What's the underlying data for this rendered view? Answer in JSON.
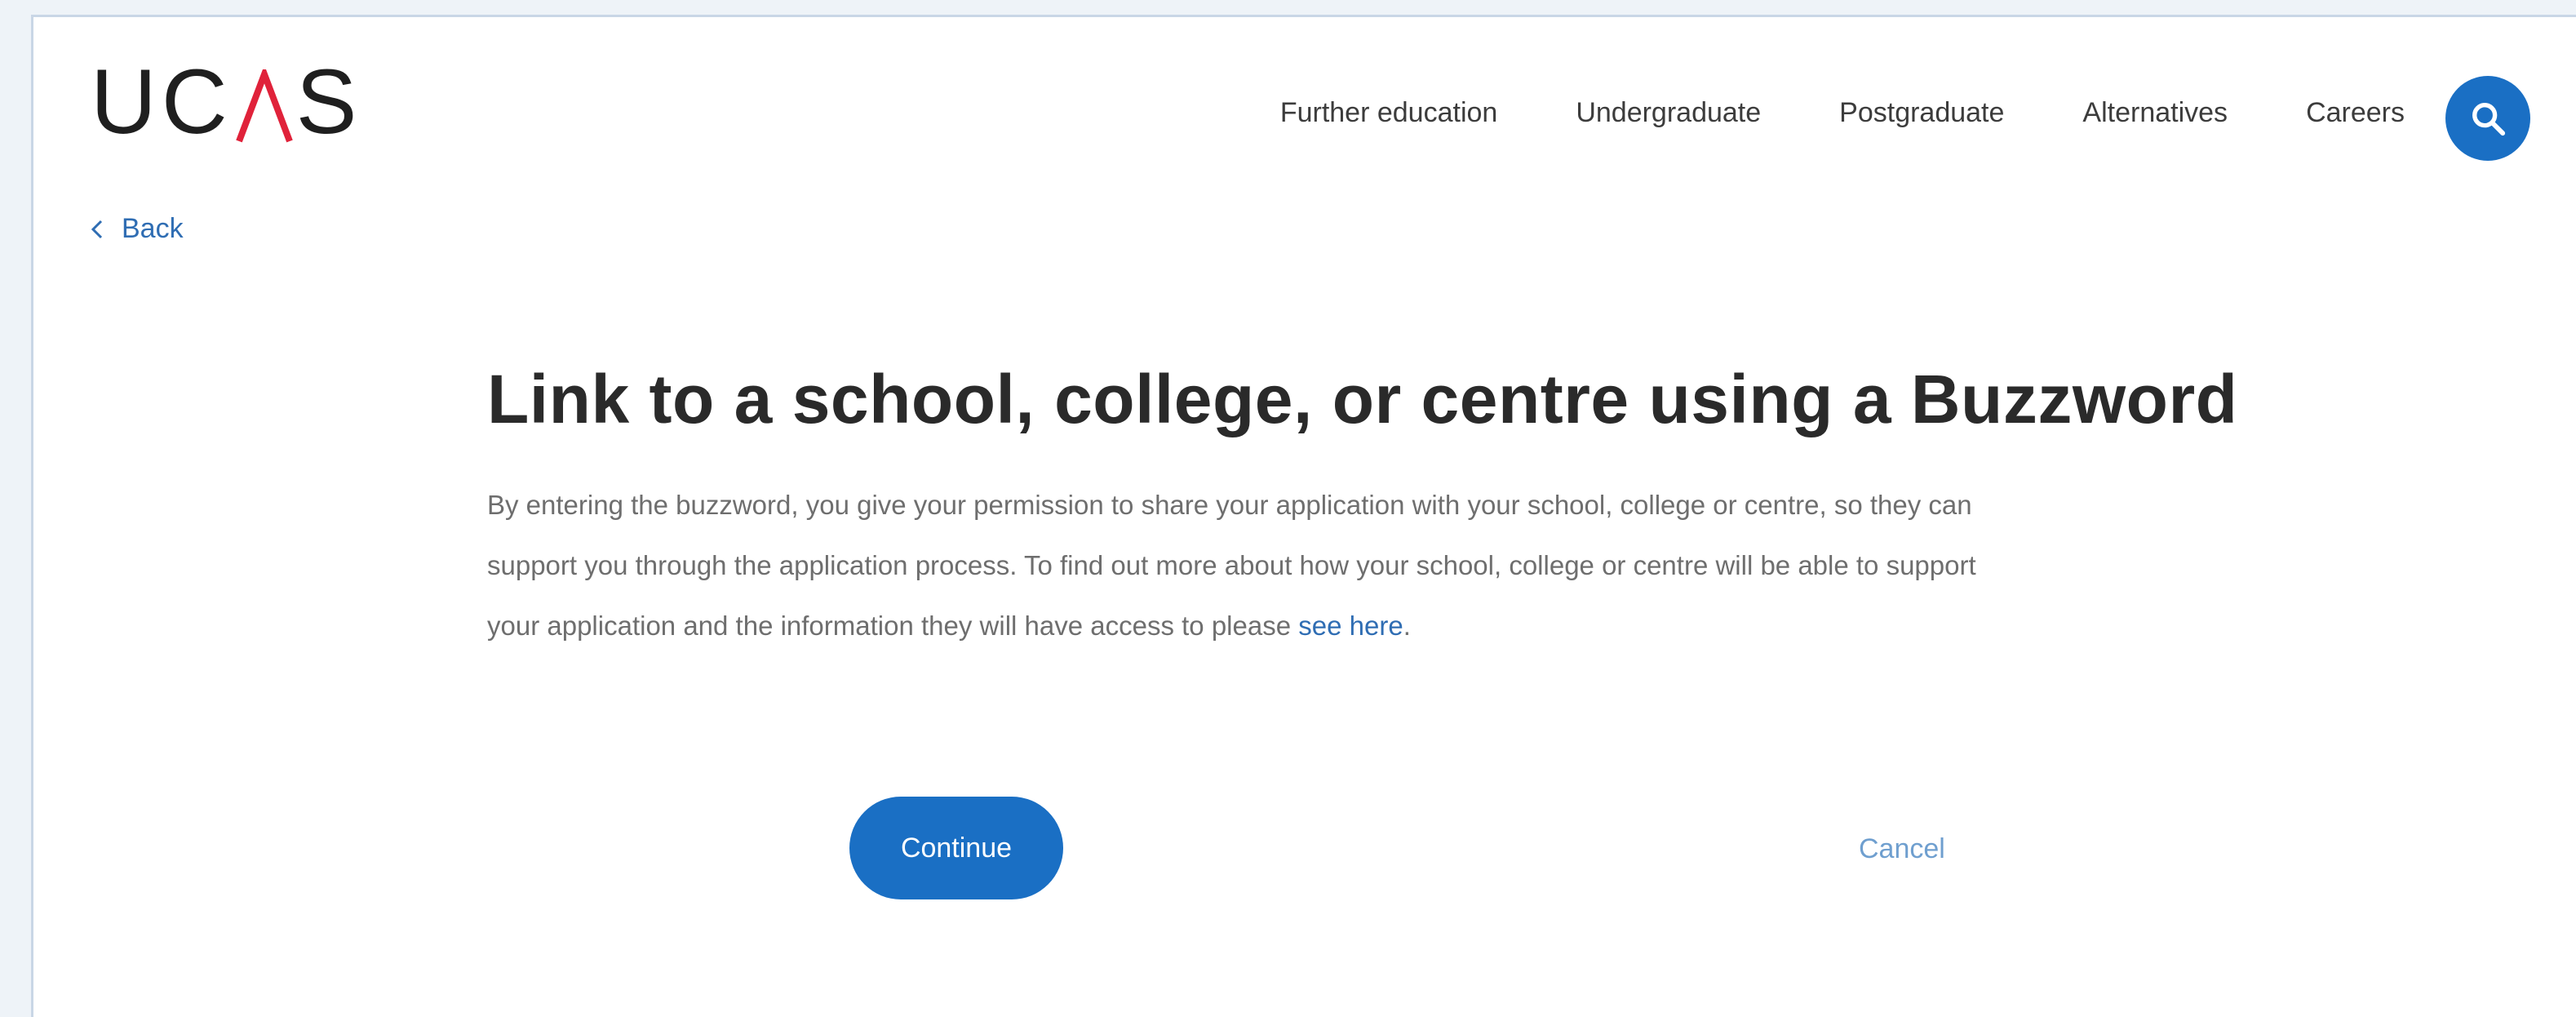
{
  "header": {
    "logo_left": "UC",
    "logo_right": "S",
    "logo_text": "UCAS",
    "nav": [
      {
        "label": "Further education"
      },
      {
        "label": "Undergraduate"
      },
      {
        "label": "Postgraduate"
      },
      {
        "label": "Alternatives"
      },
      {
        "label": "Careers"
      }
    ],
    "search_icon": "search-icon",
    "accent_color": "#1a6fc4",
    "logo_caret_color": "#e0223a"
  },
  "back": {
    "label": "Back",
    "icon": "chevron-left-icon"
  },
  "main": {
    "title": "Link to a school, college, or centre using a Buzzword",
    "paragraph_line1": "By entering the buzzword, you give your permission to share your application with your school, college or centre, so they can",
    "paragraph_line2": "support you through the application process. To find out more about how your school, college or centre will be able to support",
    "paragraph_line3": "your application and the information they will have access to please ",
    "link_text": "see here",
    "paragraph_end": "."
  },
  "actions": {
    "continue_label": "Continue",
    "cancel_label": "Cancel"
  }
}
